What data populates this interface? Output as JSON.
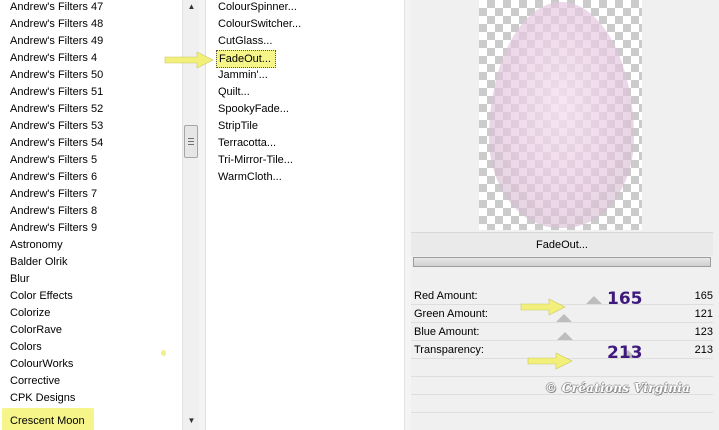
{
  "categories": [
    "Andrew's Filters 47",
    "Andrew's Filters 48",
    "Andrew's Filters 49",
    "Andrew's Filters 4",
    "Andrew's Filters 50",
    "Andrew's Filters 51",
    "Andrew's Filters 52",
    "Andrew's Filters 53",
    "Andrew's Filters 54",
    "Andrew's Filters 5",
    "Andrew's Filters 6",
    "Andrew's Filters 7",
    "Andrew's Filters 8",
    "Andrew's Filters 9",
    "Astronomy",
    "Balder Olrik",
    "Blur",
    "Color Effects",
    "Colorize",
    "ColorRave",
    "Colors",
    "ColourWorks",
    "Corrective",
    "CPK Designs",
    "Crescent Moon"
  ],
  "selected_category": "Crescent Moon",
  "filters": [
    "ColourSpinner...",
    "ColourSwitcher...",
    "CutGlass...",
    "FadeOut...",
    "Jammin'...",
    "Quilt...",
    "SpookyFade...",
    "StripTile",
    "Terracotta...",
    "Tri-Mirror-Tile...",
    "WarmCloth..."
  ],
  "selected_filter": "FadeOut...",
  "filter_title": "FadeOut...",
  "scroll_up_glyph": "▲",
  "scroll_down_glyph": "▼",
  "params": [
    {
      "label": "Red Amount:",
      "value": "165",
      "level": 0.647,
      "annotation": "165"
    },
    {
      "label": "Green Amount:",
      "value": "121",
      "level": 0.475
    },
    {
      "label": "Blue Amount:",
      "value": "123",
      "level": 0.482
    },
    {
      "label": "Transparency:",
      "value": "213",
      "level": 0.835,
      "annotation": "213"
    }
  ],
  "watermark": "© Créations Virginia",
  "colors": {
    "highlight": "#f6f58a",
    "annotation_text": "#3f1a7d",
    "arrow_fill": "#f2f07a"
  },
  "icons": {
    "arrow": "yellow-pointer-arrow-icon",
    "scroll_up": "scroll-up-icon",
    "scroll_down": "scroll-down-icon"
  }
}
